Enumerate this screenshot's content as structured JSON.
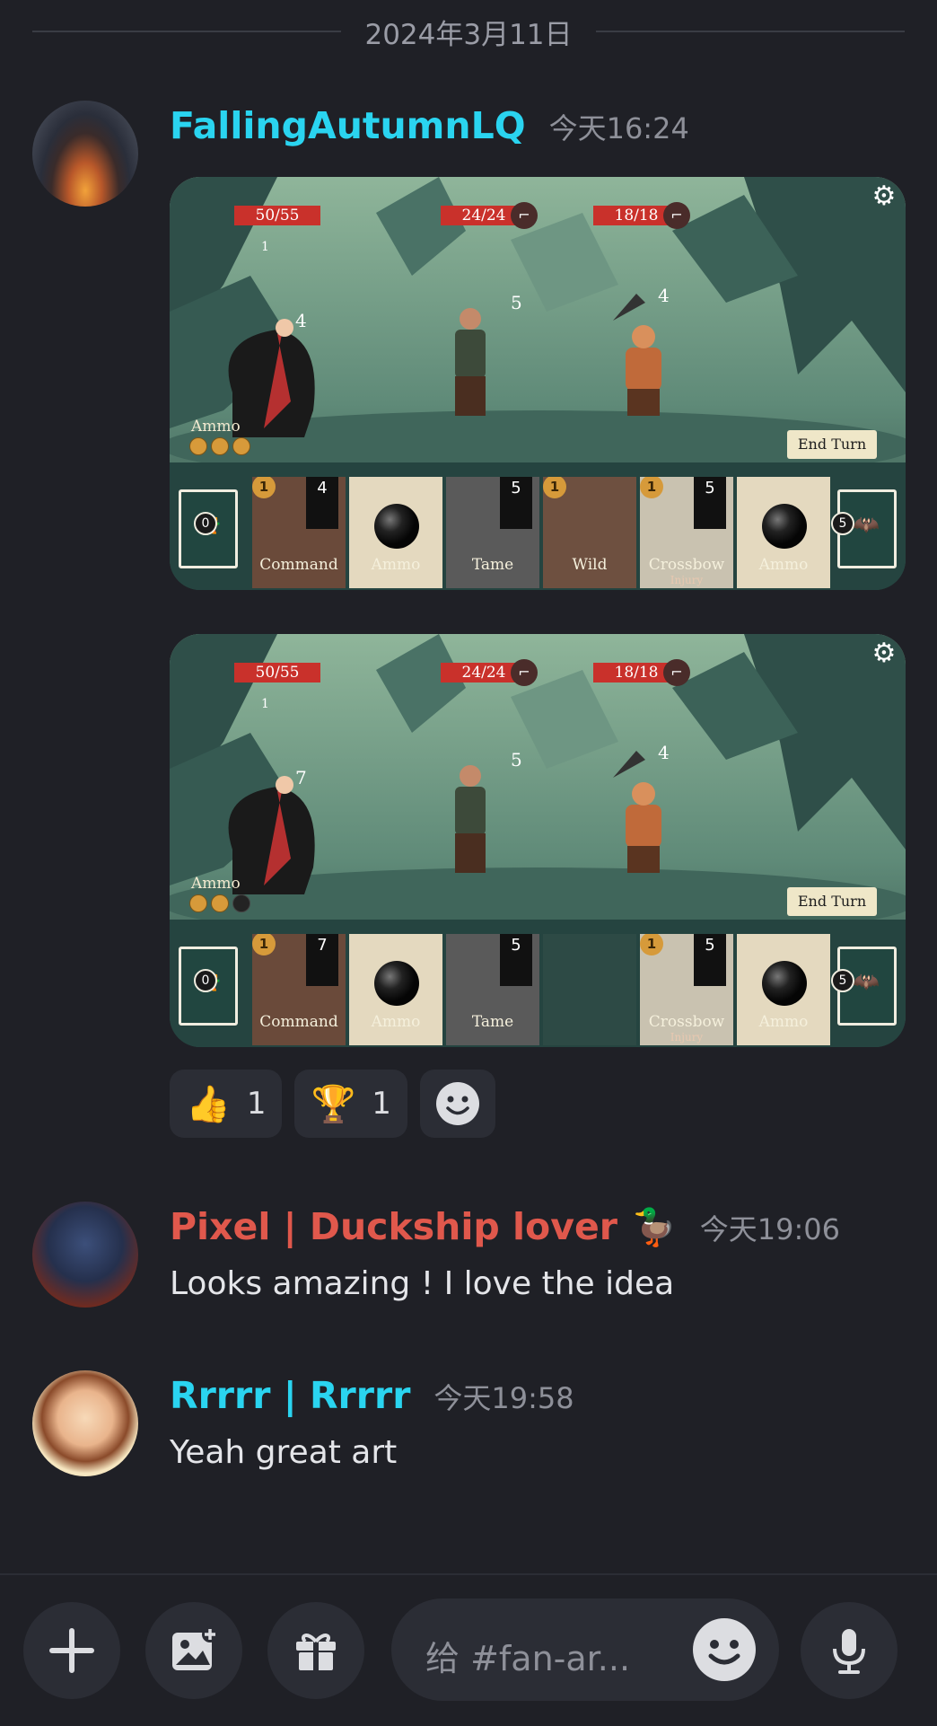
{
  "date_separator": "2024年3月11日",
  "messages": [
    {
      "username": "FallingAutumnLQ",
      "username_color": "#2ad4f0",
      "time": "今天16:24",
      "screenshots": [
        {
          "hp": [
            "50/55",
            "24/24",
            "18/18"
          ],
          "tags": [
            "1",
            "4",
            "5",
            "4"
          ],
          "ammo_label": "Ammo",
          "ammo_filled": 3,
          "ammo_total": 3,
          "end_turn": "End Turn",
          "deck_left_count": "0",
          "deck_right_count": "5",
          "cards": [
            {
              "name": "Command",
              "cost": "1",
              "value": "4"
            },
            {
              "name": "Ammo"
            },
            {
              "name": "Tame",
              "value": "5"
            },
            {
              "name": "Wild",
              "cost": "1"
            },
            {
              "name": "Crossbow",
              "sub": "Injury",
              "cost": "1",
              "value": "5"
            },
            {
              "name": "Ammo"
            }
          ]
        },
        {
          "hp": [
            "50/55",
            "24/24",
            "18/18"
          ],
          "tags": [
            "1",
            "7",
            "5",
            "4"
          ],
          "ammo_label": "Ammo",
          "ammo_filled": 2,
          "ammo_total": 3,
          "end_turn": "End Turn",
          "deck_left_count": "0",
          "deck_right_count": "5",
          "cards": [
            {
              "name": "Command",
              "cost": "1",
              "value": "7"
            },
            {
              "name": "Ammo"
            },
            {
              "name": "Tame",
              "value": "5"
            },
            {
              "name": ""
            },
            {
              "name": "Crossbow",
              "sub": "Injury",
              "cost": "1",
              "value": "5"
            },
            {
              "name": "Ammo"
            }
          ]
        }
      ],
      "reactions": [
        {
          "emoji": "👍",
          "count": "1",
          "icon": "thumbs-up-icon"
        },
        {
          "emoji": "🏆",
          "count": "1",
          "icon": "trophy-icon"
        }
      ]
    },
    {
      "username": "Pixel | Duckship lover",
      "username_emoji": "🦆",
      "username_color": "#e0584c",
      "time": "今天19:06",
      "text": "Looks amazing ! I love the idea"
    },
    {
      "username": "Rrrrr | Rrrrr",
      "username_color": "#2ad4f0",
      "time": "今天19:58",
      "text": "Yeah great art"
    }
  ],
  "composer": {
    "placeholder": "给 #fan-ar...",
    "buttons": [
      "plus-icon",
      "image-icon",
      "gift-icon",
      "emoji-icon",
      "microphone-icon"
    ]
  }
}
